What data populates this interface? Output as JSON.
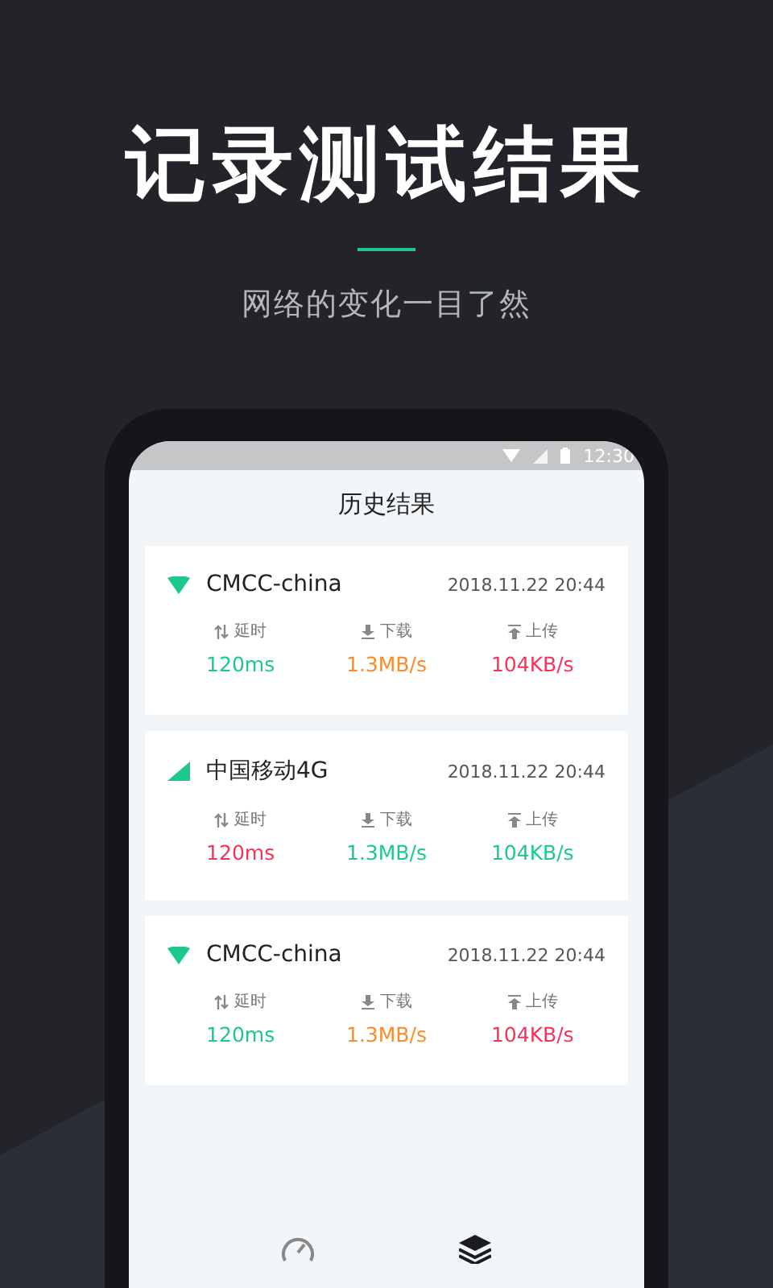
{
  "headline": "记录测试结果",
  "subtitle": "网络的变化一目了然",
  "status_bar": {
    "time": "12:30"
  },
  "screen_title": "历史结果",
  "results": [
    {
      "network": {
        "kind": "wifi",
        "name": "CMCC-china"
      },
      "time": "2018.11.22 20:44",
      "metrics": [
        {
          "kind": "latency",
          "label": "延时",
          "value": "120ms",
          "color": "#1dc98a"
        },
        {
          "kind": "download",
          "label": "下载",
          "value": "1.3MB/s",
          "color": "#fb8b2a"
        },
        {
          "kind": "upload",
          "label": "上传",
          "value": "104KB/s",
          "color": "#f5345a"
        }
      ]
    },
    {
      "network": {
        "kind": "cellular",
        "name": "中国移动4G"
      },
      "time": "2018.11.22 20:44",
      "metrics": [
        {
          "kind": "latency",
          "label": "延时",
          "value": "120ms",
          "color": "#f5345a"
        },
        {
          "kind": "download",
          "label": "下载",
          "value": "1.3MB/s",
          "color": "#1dc98a"
        },
        {
          "kind": "upload",
          "label": "上传",
          "value": "104KB/s",
          "color": "#1dc98a"
        }
      ]
    },
    {
      "network": {
        "kind": "wifi",
        "name": "CMCC-china"
      },
      "time": "2018.11.22 20:44",
      "metrics": [
        {
          "kind": "latency",
          "label": "延时",
          "value": "120ms",
          "color": "#1dc98a"
        },
        {
          "kind": "download",
          "label": "下载",
          "value": "1.3MB/s",
          "color": "#fb8b2a"
        },
        {
          "kind": "upload",
          "label": "上传",
          "value": "104KB/s",
          "color": "#f5345a"
        }
      ]
    }
  ],
  "nav": [
    {
      "kind": "speed",
      "selected": false
    },
    {
      "kind": "history",
      "selected": true
    }
  ]
}
